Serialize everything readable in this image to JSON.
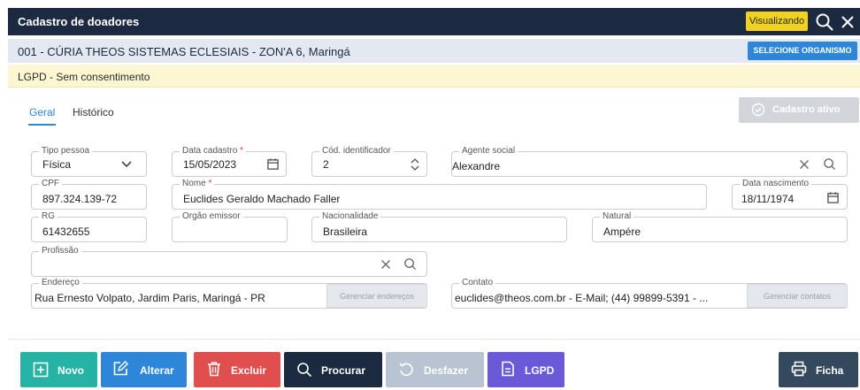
{
  "titlebar": {
    "title": "Cadastro de doadores",
    "badge": "Visualizando"
  },
  "org": {
    "text": "001 - CÚRIA THEOS SISTEMAS ECLESIAIS - ZON'A 6, Maringá",
    "button": "SELECIONE ORGANISMO"
  },
  "lgpd": {
    "text": "LGPD - Sem consentimento"
  },
  "tabs": [
    {
      "label": "Geral"
    },
    {
      "label": "Histórico"
    }
  ],
  "status_button": "Cadastro ativo",
  "fields": {
    "tipo_pessoa": {
      "label": "Tipo pessoa",
      "value": "Física"
    },
    "data_cadastro": {
      "label": "Data cadastro",
      "required": "*",
      "value": "15/05/2023"
    },
    "cod_identificador": {
      "label": "Cód. identificador",
      "value": "2"
    },
    "agente_social": {
      "label": "Agente social",
      "value": "Alexandre"
    },
    "cpf": {
      "label": "CPF",
      "value": "897.324.139-72"
    },
    "nome": {
      "label": "Nome",
      "required": "*",
      "value": "Euclides Geraldo Machado Faller"
    },
    "data_nascimento": {
      "label": "Data nascimento",
      "value": "18/11/1974"
    },
    "rg": {
      "label": "RG",
      "value": "61432655"
    },
    "orgao_emissor": {
      "label": "Orgão emissor",
      "value": ""
    },
    "nacionalidade": {
      "label": "Nacionalidade",
      "value": "Brasileira"
    },
    "natural": {
      "label": "Natural",
      "value": "Ampére"
    },
    "profissao": {
      "label": "Profissão",
      "value": ""
    },
    "endereco": {
      "label": "Endereço",
      "value": "Rua Ernesto Volpato, Jardim Paris, Maringá - PR",
      "button": "Gerenciar endereços"
    },
    "contato": {
      "label": "Contato",
      "value": "euclides@theos.com.br - E-Mail; (44) 99899-5391 - ...",
      "button": "Gerenciar contatos"
    }
  },
  "actions": {
    "novo": "Novo",
    "alterar": "Alterar",
    "excluir": "Excluir",
    "procurar": "Procurar",
    "desfazer": "Desfazer",
    "lgpd": "LGPD",
    "ficha": "Ficha"
  },
  "colors": {
    "titlebar": "#1b2a40",
    "badge": "#f3d11c",
    "accent": "#2e86d9",
    "novo": "#26b3a6",
    "alterar": "#2e86d9",
    "excluir": "#e04e4e",
    "procurar": "#1b2a40",
    "desfazer": "#b8c4d2",
    "lgpd": "#6a5ad8",
    "ficha": "#34495e"
  },
  "icons": [
    "search-icon",
    "close-icon",
    "calendar-icon",
    "chevron-down-icon",
    "spin-arrows-icon",
    "clear-icon",
    "check-circle-icon",
    "plus-square-icon",
    "edit-icon",
    "trash-icon",
    "undo-icon",
    "document-icon",
    "printer-icon"
  ]
}
